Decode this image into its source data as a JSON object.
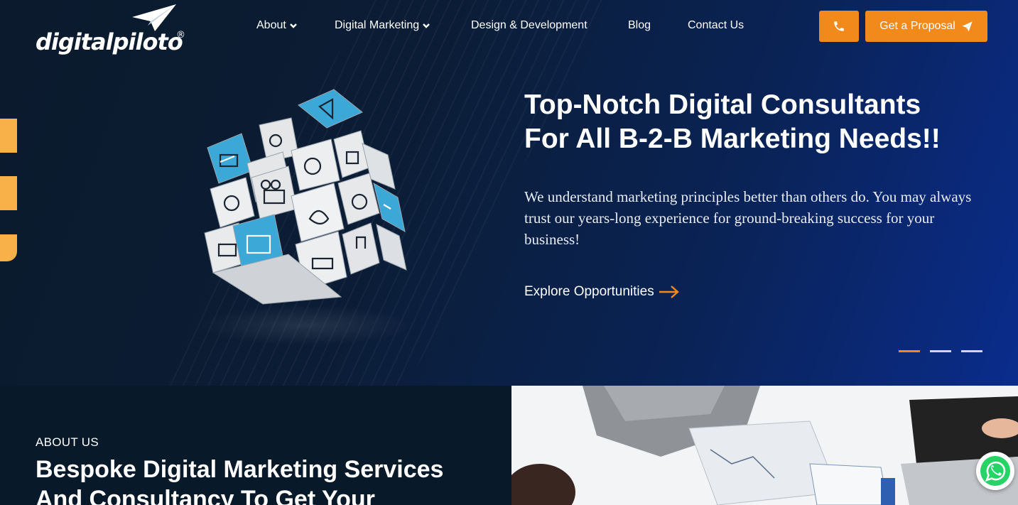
{
  "brand": {
    "name": "digitalpiloto",
    "reg": "®"
  },
  "nav": {
    "items": [
      {
        "label": "About",
        "dropdown": true
      },
      {
        "label": "Digital Marketing",
        "dropdown": true
      },
      {
        "label": "Design & Development",
        "dropdown": false
      },
      {
        "label": "Blog",
        "dropdown": false
      },
      {
        "label": "Contact Us",
        "dropdown": false
      }
    ]
  },
  "header": {
    "proposal_label": "Get a Proposal",
    "phone_icon": "phone-icon"
  },
  "hero": {
    "title_line1": "Top-Notch Digital Consultants",
    "title_line2": "For All B-2-B Marketing Needs!!",
    "text": "We understand marketing principles better than others do. You may always trust our years-long experience for ground-breaking success for your business!",
    "cta": "Explore Opportunities",
    "slides": 3,
    "active_slide": 1
  },
  "about": {
    "label": "ABOUT US",
    "title": "Bespoke Digital Marketing Services And Consultancy To Get Your"
  },
  "colors": {
    "accent": "#f28a1b",
    "side_tab": "#f7b148",
    "cube_blue": "#3ba8d8",
    "whatsapp": "#25d366"
  }
}
